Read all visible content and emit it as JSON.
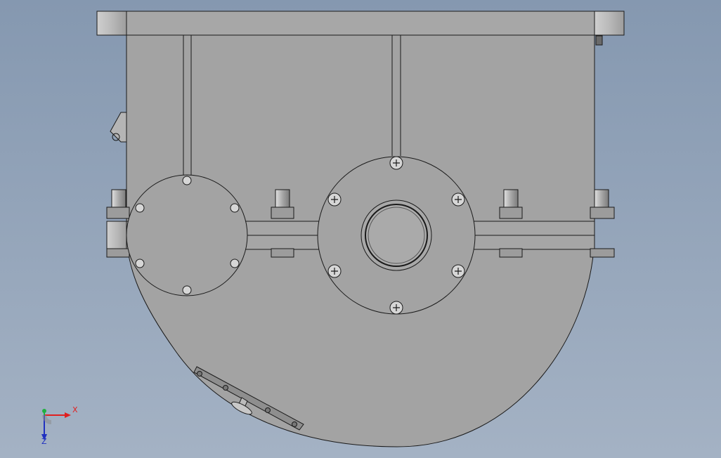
{
  "viewport": {
    "background_top": "#8598b0",
    "background_bottom": "#a4b2c4",
    "part_color": "#a3a3a3",
    "edge_color": "#1a1a1a"
  },
  "triad": {
    "x_label": "X",
    "z_label": "Z",
    "x_color": "#e02020",
    "y_color": "#20b040",
    "z_color": "#2030c0"
  }
}
